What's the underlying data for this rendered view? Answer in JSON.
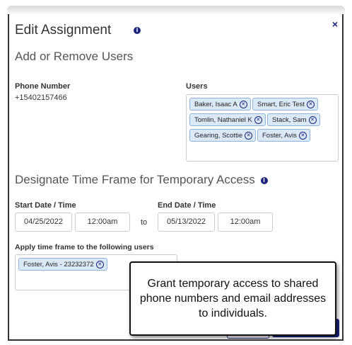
{
  "dialog": {
    "title": "Edit Assignment",
    "close_label": "×",
    "info_glyph": "i"
  },
  "section_users": {
    "heading": "Add or Remove Users",
    "phone_label": "Phone Number",
    "phone_value": "+15402157466",
    "users_label": "Users",
    "users": [
      {
        "name": "Baker, Isaac A"
      },
      {
        "name": "Smart, Eric Test"
      },
      {
        "name": "Tomlin, Nathaniel K"
      },
      {
        "name": "Stack, Sam"
      },
      {
        "name": "Gearing, Scottie"
      },
      {
        "name": "Foster, Avis"
      }
    ]
  },
  "section_time": {
    "heading": "Designate Time Frame for Temporary Access",
    "start_label": "Start Date / Time",
    "start_date": "04/25/2022",
    "start_time": "12:00am",
    "to_label": "to",
    "end_label": "End Date / Time",
    "end_date": "05/13/2022",
    "end_time": "12:00am",
    "apply_label": "Apply time frame to the following users",
    "apply_users": [
      {
        "name": "Foster, Avis - 23232372"
      }
    ]
  },
  "callout": {
    "text": "Grant temporary access to shared phone numbers and email addresses to individuals."
  },
  "colors": {
    "accent": "#1a237e",
    "chip_bg": "#dbe9f6",
    "chip_border": "#8fb3d9"
  },
  "icons": {
    "chip_remove": "close-circle-icon",
    "info": "info-icon",
    "close": "close-icon"
  }
}
